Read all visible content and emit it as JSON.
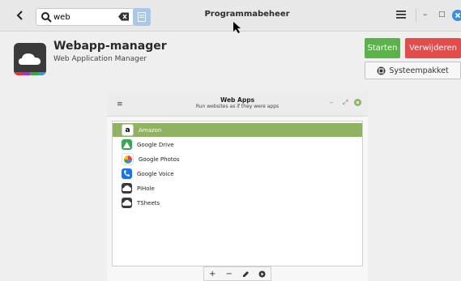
{
  "header": {
    "search_value": "web",
    "title": "Programmabeheer"
  },
  "app": {
    "name": "Webapp-manager",
    "subtitle": "Web Application Manager"
  },
  "actions": {
    "start_label": "Starten",
    "remove_label": "Verwijderen",
    "system_package_label": "Systeempakket"
  },
  "screenshot": {
    "title": "Web Apps",
    "subtitle": "Run websites as if they were apps",
    "items": [
      {
        "label": "Amazon",
        "icon": "amazon-icon",
        "selected": true
      },
      {
        "label": "Google Drive",
        "icon": "google-drive-icon",
        "selected": false
      },
      {
        "label": "Google Photos",
        "icon": "google-photos-icon",
        "selected": false
      },
      {
        "label": "Google Voice",
        "icon": "google-voice-icon",
        "selected": false
      },
      {
        "label": "PiHole",
        "icon": "cloud-icon",
        "selected": false
      },
      {
        "label": "TSheets",
        "icon": "cloud-icon",
        "selected": false
      }
    ],
    "toolbar": {
      "add": "+",
      "remove": "−"
    }
  },
  "colors": {
    "start": "#5bb24a",
    "remove": "#e44b4b",
    "selection": "#8fb263",
    "search_button": "#a9c7e8"
  }
}
